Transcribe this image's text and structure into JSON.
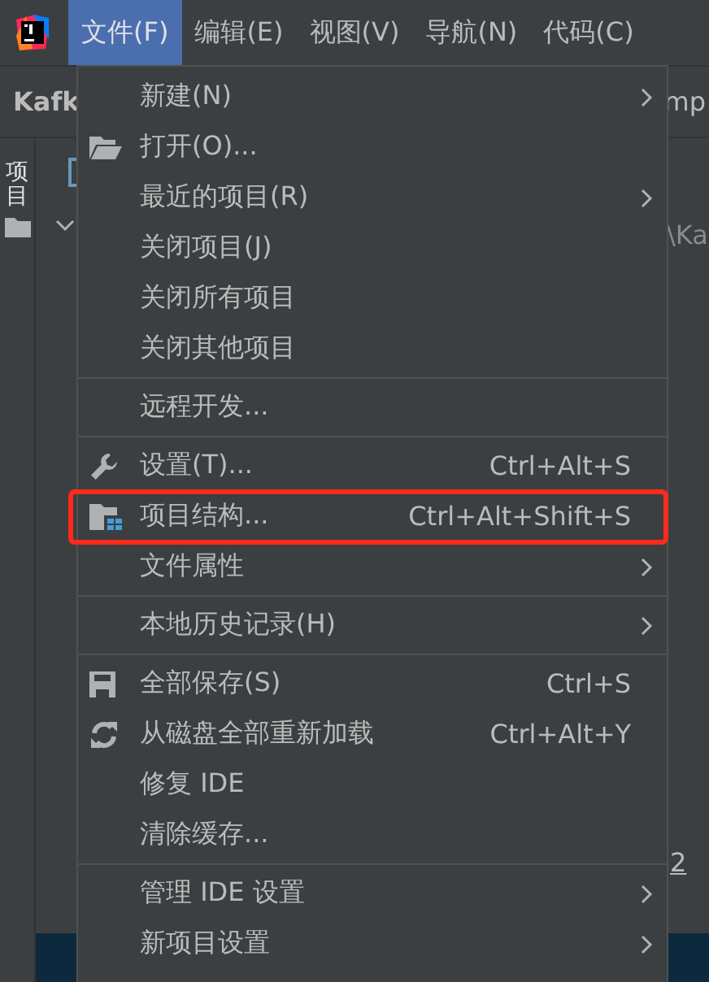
{
  "menubar": [
    {
      "label": "文件(F)",
      "selected": true
    },
    {
      "label": "编辑(E)",
      "selected": false
    },
    {
      "label": "视图(V)",
      "selected": false
    },
    {
      "label": "导航(N)",
      "selected": false
    },
    {
      "label": "代码(C)",
      "selected": false
    }
  ],
  "background": {
    "toolbar_left": "Kafk",
    "toolbar_right": "mp",
    "side_tab": "项目",
    "path_fragment": "\\Ka",
    "line_fragment": "2"
  },
  "menu": [
    {
      "kind": "item",
      "label": "新建(N)",
      "submenu": true
    },
    {
      "kind": "item",
      "label": "打开(O)..."
    },
    {
      "kind": "item",
      "label": "最近的项目(R)",
      "submenu": true
    },
    {
      "kind": "item",
      "label": "关闭项目(J)"
    },
    {
      "kind": "item",
      "label": "关闭所有项目"
    },
    {
      "kind": "item",
      "label": "关闭其他项目"
    },
    {
      "kind": "separator"
    },
    {
      "kind": "item",
      "label": "远程开发..."
    },
    {
      "kind": "separator"
    },
    {
      "kind": "item",
      "label": "设置(T)...",
      "shortcut": "Ctrl+Alt+S"
    },
    {
      "kind": "item",
      "label": "项目结构...",
      "shortcut": "Ctrl+Alt+Shift+S",
      "highlighted": true
    },
    {
      "kind": "item",
      "label": "文件属性",
      "submenu": true
    },
    {
      "kind": "separator"
    },
    {
      "kind": "item",
      "label": "本地历史记录(H)",
      "submenu": true
    },
    {
      "kind": "separator"
    },
    {
      "kind": "item",
      "label": "全部保存(S)",
      "shortcut": "Ctrl+S"
    },
    {
      "kind": "item",
      "label": "从磁盘全部重新加载",
      "shortcut": "Ctrl+Alt+Y"
    },
    {
      "kind": "item",
      "label": "修复 IDE"
    },
    {
      "kind": "item",
      "label": "清除缓存..."
    },
    {
      "kind": "separator"
    },
    {
      "kind": "item",
      "label": "管理 IDE 设置",
      "submenu": true
    },
    {
      "kind": "item",
      "label": "新项目设置",
      "submenu": true
    }
  ]
}
